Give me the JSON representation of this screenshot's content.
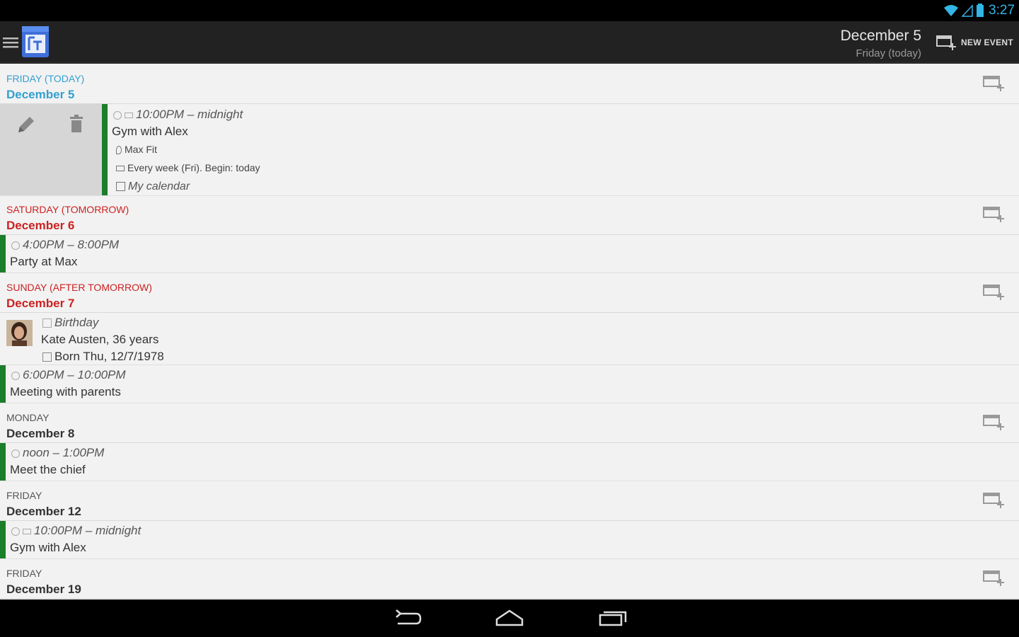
{
  "status": {
    "time": "3:27",
    "accent": "#33b5e5"
  },
  "actionbar": {
    "date_title": "December 5",
    "date_subtitle": "Friday (today)",
    "new_event_label": "NEW EVENT",
    "logo_text": "DAY"
  },
  "colors": {
    "today": "#33a0d0",
    "upcoming": "#cc2222",
    "normal": "#333333",
    "event_bar": "#1b7e2a"
  },
  "days": [
    {
      "dow": "FRIDAY (TODAY)",
      "date": "December 5"
    },
    {
      "dow": "SATURDAY (TOMORROW)",
      "date": "December 6"
    },
    {
      "dow": "SUNDAY (AFTER TOMORROW)",
      "date": "December 7"
    },
    {
      "dow": "MONDAY",
      "date": "December 8"
    },
    {
      "dow": "FRIDAY",
      "date": "December 12"
    },
    {
      "dow": "FRIDAY",
      "date": "December 19"
    }
  ],
  "events": [
    {
      "time": "10:00PM – midnight",
      "title": "Gym with Alex",
      "location": "Max Fit",
      "recurrence": "Every week (Fri). Begin: today",
      "calendar": "My calendar"
    },
    {
      "time": "4:00PM – 8:00PM",
      "title": "Party at Max"
    },
    {
      "time": "Birthday",
      "title": "Kate Austen, 36 years",
      "detail": "Born Thu, 12/7/1978"
    },
    {
      "time": "6:00PM – 10:00PM",
      "title": "Meeting with parents"
    },
    {
      "time": "noon – 1:00PM",
      "title": "Meet the chief"
    },
    {
      "time": "10:00PM – midnight",
      "title": "Gym with Alex"
    }
  ]
}
